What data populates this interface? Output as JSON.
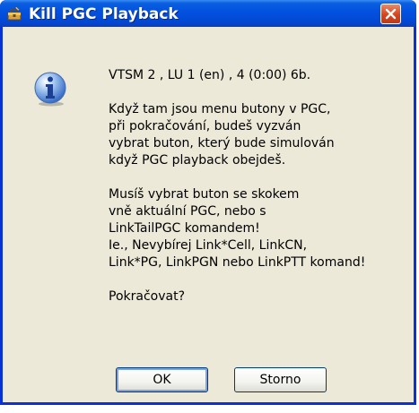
{
  "window": {
    "title": "Kill PGC Playback",
    "icons": {
      "app": "toolbox-icon",
      "close": "close-icon",
      "message": "information-icon"
    }
  },
  "message": {
    "paragraphs": [
      [
        "VTSM 2 , LU 1 (en) , 4  (0:00)  6b."
      ],
      [
        "Když tam jsou menu butony v PGC,",
        "při pokračování, budeš vyzván",
        "vybrat buton, který bude simulován",
        "když PGC playback obejdeš."
      ],
      [
        "Musíš vybrat buton se skokem",
        "vně aktuální PGC, nebo s",
        "LinkTailPGC komandem!",
        "Ie., Nevybírej Link*Cell, LinkCN,",
        "Link*PG, LinkPGN nebo LinkPTT komand!"
      ],
      [
        "Pokračovat?"
      ]
    ]
  },
  "buttons": {
    "ok": "OK",
    "cancel": "Storno"
  },
  "colors": {
    "titlebar": "#0352e0",
    "frame": "#0831d9",
    "dialog": "#ece9d8",
    "close": "#d6431d"
  }
}
